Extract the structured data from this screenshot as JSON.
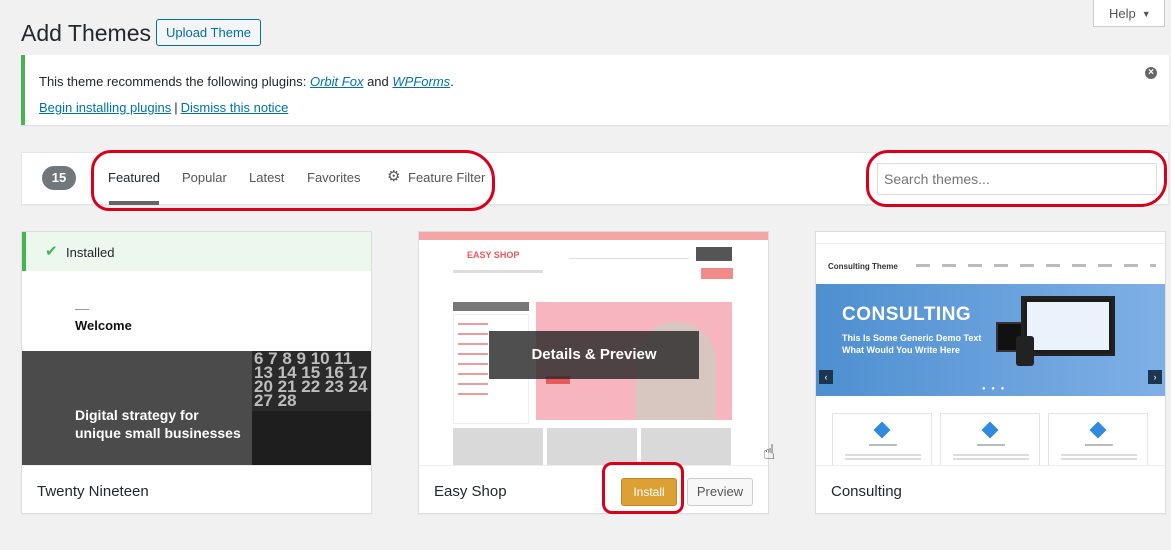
{
  "help": {
    "label": "Help",
    "arrow": "▼"
  },
  "header": {
    "title": "Add Themes",
    "upload_label": "Upload Theme"
  },
  "notice": {
    "prefix": "This theme recommends the following plugins:",
    "plugin1": "Orbit Fox",
    "and": "and",
    "plugin2": "WPForms",
    "suffix": ".",
    "begin_label": "Begin installing plugins",
    "separator": "|",
    "dismiss_label": "Dismiss this notice",
    "close_icon": "×"
  },
  "filter": {
    "count": "15",
    "tabs": [
      "Featured",
      "Popular",
      "Latest",
      "Favorites"
    ],
    "feature_filter": "Feature Filter",
    "gear_icon": "⚙",
    "search_placeholder": "Search themes..."
  },
  "themes": [
    {
      "name": "Twenty Nineteen",
      "installed_label": "Installed",
      "check_icon": "✔",
      "preview_heading": "Welcome",
      "preview_text_1": "Digital strategy for",
      "preview_text_2": "unique small businesses",
      "preview_calendar": "6 7 8 9 10 11\n13 14 15 16 17\n20 21 22 23 24\n27 28"
    },
    {
      "name": "Easy Shop",
      "preview_logo": "EASY SHOP",
      "overlay_label": "Details & Preview",
      "install_label": "Install",
      "preview_label": "Preview"
    },
    {
      "name": "Consulting",
      "preview_brand": "Consulting Theme",
      "preview_heading": "CONSULTING",
      "preview_sub_1": "This Is Some Generic Demo Text",
      "preview_sub_2": "What Would You Write Here",
      "left_arrow": "‹",
      "right_arrow": "›",
      "dots": "● ● ●"
    }
  ],
  "colors": {
    "annotation_red": "#d9001b",
    "success_green": "#46b450",
    "link_blue": "#0073aa",
    "install_orange": "#dda034"
  }
}
